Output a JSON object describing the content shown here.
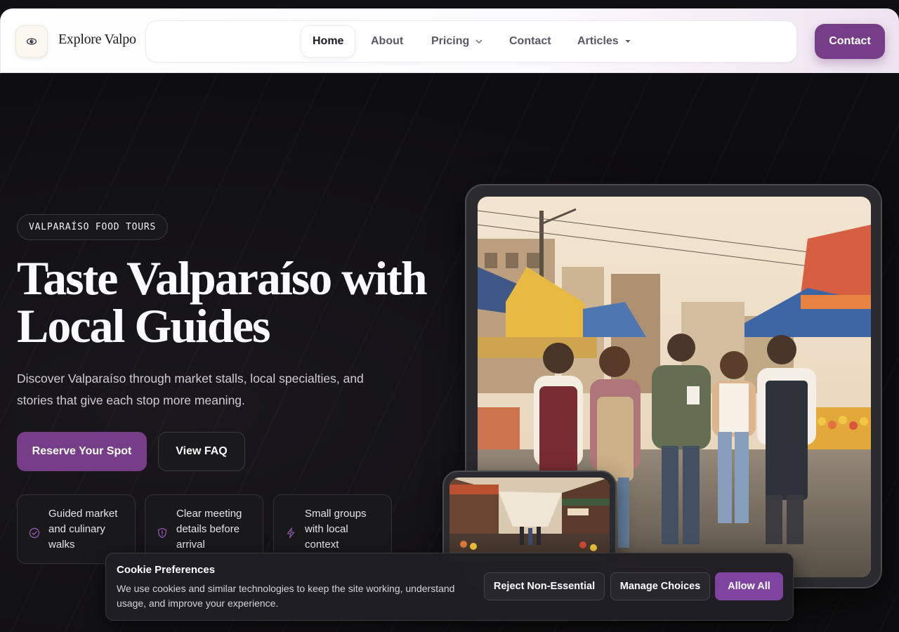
{
  "brand": {
    "name": "Explore Valpo",
    "logo_icon": "eye-logo-icon"
  },
  "nav": {
    "items": [
      {
        "label": "Home",
        "active": true
      },
      {
        "label": "About"
      },
      {
        "label": "Pricing",
        "chevron": "chevron-down-icon"
      },
      {
        "label": "Contact"
      },
      {
        "label": "Articles",
        "chevron": "caret-down-icon"
      }
    ],
    "cta_label": "Contact"
  },
  "hero": {
    "eyebrow": "VALPARAÍSO FOOD TOURS",
    "title_line1": "Taste Valparaíso with",
    "title_line2": "Local Guides",
    "subtitle": "Discover Valparaíso through market stalls, local specialties, and stories that give each stop more meaning.",
    "primary_cta": "Reserve Your Spot",
    "secondary_cta": "View FAQ",
    "features": [
      {
        "icon": "check-circle-icon",
        "text": "Guided market and culinary walks"
      },
      {
        "icon": "shield-icon",
        "text": "Clear meeting details before arrival"
      },
      {
        "icon": "lightning-icon",
        "text": "Small groups with local context"
      }
    ]
  },
  "cookie": {
    "title": "Cookie Preferences",
    "text": "We use cookies and similar technologies to keep the site working, understand usage, and improve your experience.",
    "reject_label": "Reject Non-Essential",
    "manage_label": "Manage Choices",
    "allow_label": "Allow All"
  },
  "colors": {
    "accent": "#773e88",
    "background": "#0f0e10",
    "nav_bg": "#ffffff"
  }
}
